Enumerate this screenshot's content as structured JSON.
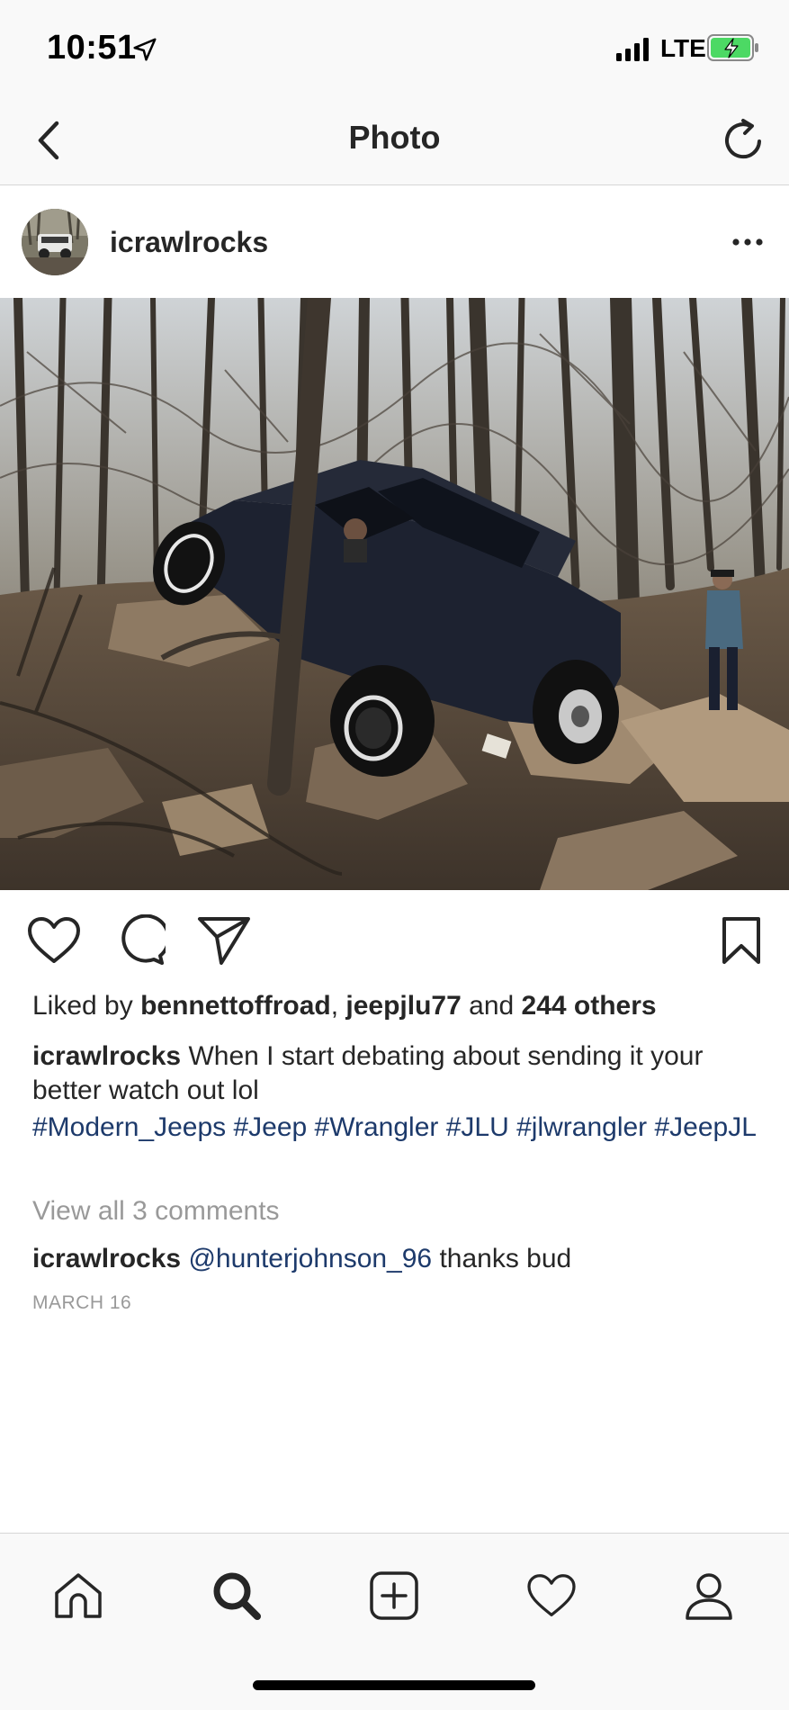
{
  "status_bar": {
    "time": "10:51",
    "carrier": "LTE",
    "battery_color": "#4cd964"
  },
  "nav": {
    "title": "Photo",
    "icons": [
      "back-chevron-icon",
      "refresh-icon"
    ]
  },
  "post": {
    "username": "icrawlrocks",
    "photo_description": "jeep-off-road-photo",
    "likes": {
      "prefix": "Liked by ",
      "user1": "bennettoffroad",
      "sep": ", ",
      "user2": "jeepjlu77",
      "and": " and ",
      "others": "244 others"
    },
    "caption": {
      "username": "icrawlrocks",
      "text": " When I start debating about sending it your better watch out lol"
    },
    "hashtags": "#Modern_Jeeps #Jeep #Wrangler #JLU #jlwrangler #JeepJL",
    "view_comments": "View all 3 comments",
    "comment": {
      "username": "icrawlrocks",
      "mention": "@hunterjohnson_96",
      "text": " thanks bud"
    },
    "date": "MARCH 16"
  },
  "colors": {
    "text": "#262626",
    "link": "#1d3a6b",
    "muted": "#999999",
    "bar_bg": "#f9f9f9"
  },
  "tab_bar": {
    "tabs": [
      "home-icon",
      "search-icon",
      "add-post-icon",
      "activity-heart-icon",
      "profile-icon"
    ],
    "active": "search-icon"
  }
}
